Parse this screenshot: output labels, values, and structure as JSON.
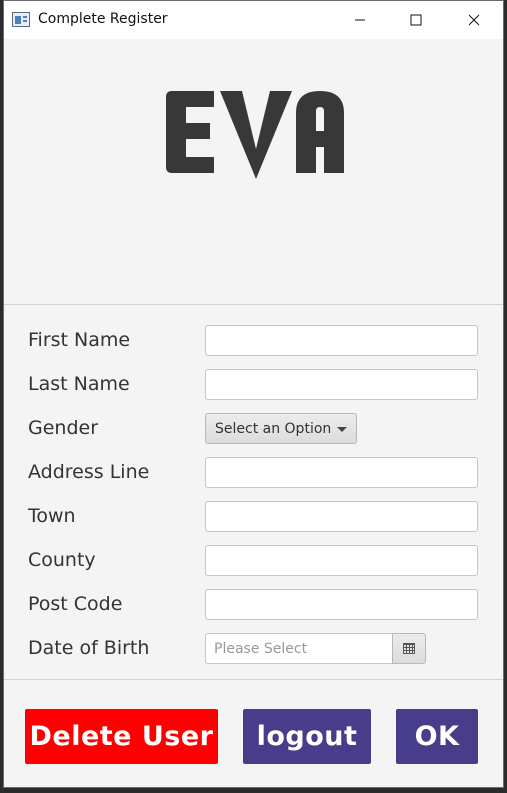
{
  "window": {
    "title": "Complete Register"
  },
  "logo": {
    "text": "EVA",
    "color": "#383838"
  },
  "form": {
    "fields": [
      {
        "label": "First Name",
        "value": ""
      },
      {
        "label": "Last Name",
        "value": ""
      },
      {
        "label": "Gender",
        "selected": "Select an Option"
      },
      {
        "label": "Address Line",
        "value": ""
      },
      {
        "label": "Town",
        "value": ""
      },
      {
        "label": "County",
        "value": ""
      },
      {
        "label": "Post Code",
        "value": ""
      },
      {
        "label": "Date of Birth",
        "placeholder": "Please Select"
      }
    ]
  },
  "buttons": {
    "delete": "Delete User",
    "logout": "logout",
    "ok": "OK"
  },
  "colors": {
    "delete_bg": "#ff0000",
    "primary_bg": "#483d8b"
  }
}
